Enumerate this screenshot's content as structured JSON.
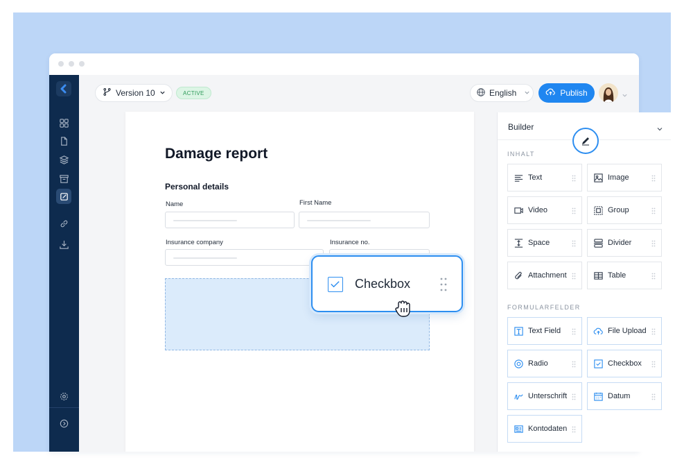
{
  "toolbar": {
    "version_label": "Version 10",
    "status_badge": "ACTIVE",
    "language": "English",
    "publish_label": "Publish"
  },
  "document": {
    "title": "Damage report",
    "section": "Personal details",
    "fields": [
      {
        "label": "Name"
      },
      {
        "label": "First Name"
      },
      {
        "label": "Insurance company"
      },
      {
        "label": "Insurance no."
      }
    ]
  },
  "drag_item": {
    "label": "Checkbox",
    "icon": "checkbox-icon"
  },
  "builder": {
    "title": "Builder",
    "content_section": "INHALT",
    "content_tiles": [
      {
        "label": "Text",
        "icon": "text-icon"
      },
      {
        "label": "Image",
        "icon": "image-icon"
      },
      {
        "label": "Video",
        "icon": "video-icon"
      },
      {
        "label": "Group",
        "icon": "group-icon"
      },
      {
        "label": "Space",
        "icon": "space-icon"
      },
      {
        "label": "Divider",
        "icon": "divider-icon"
      },
      {
        "label": "Attachment",
        "icon": "paperclip-icon"
      },
      {
        "label": "Table",
        "icon": "table-icon"
      }
    ],
    "form_section": "FORMULARFELDER",
    "form_tiles": [
      {
        "label": "Text Field",
        "icon": "text-field-icon"
      },
      {
        "label": "File Upload",
        "icon": "cloud-upload-icon"
      },
      {
        "label": "Radio",
        "icon": "radio-icon"
      },
      {
        "label": "Checkbox",
        "icon": "checkbox-icon"
      },
      {
        "label": "Unterschrift",
        "icon": "signature-icon"
      },
      {
        "label": "Datum",
        "icon": "calendar-icon"
      },
      {
        "label": "Kontodaten",
        "icon": "account-card-icon"
      }
    ]
  },
  "sidebar": {
    "items": [
      {
        "icon": "grid-icon"
      },
      {
        "icon": "document-icon"
      },
      {
        "icon": "layers-icon"
      },
      {
        "icon": "archive-icon"
      },
      {
        "icon": "edit-document-icon",
        "active": true
      },
      {
        "icon": "link-icon"
      },
      {
        "icon": "download-icon"
      }
    ],
    "bottom": [
      {
        "icon": "settings-icon"
      },
      {
        "icon": "chevron-right-circle-icon"
      }
    ]
  },
  "colors": {
    "accent": "#1f86f0",
    "sidebar": "#0e2b4e",
    "badge_bg": "#dcf5e5",
    "badge_text": "#2f9a5a",
    "dropzone": "#dbebfb",
    "backdrop": "#bcd6f7"
  }
}
